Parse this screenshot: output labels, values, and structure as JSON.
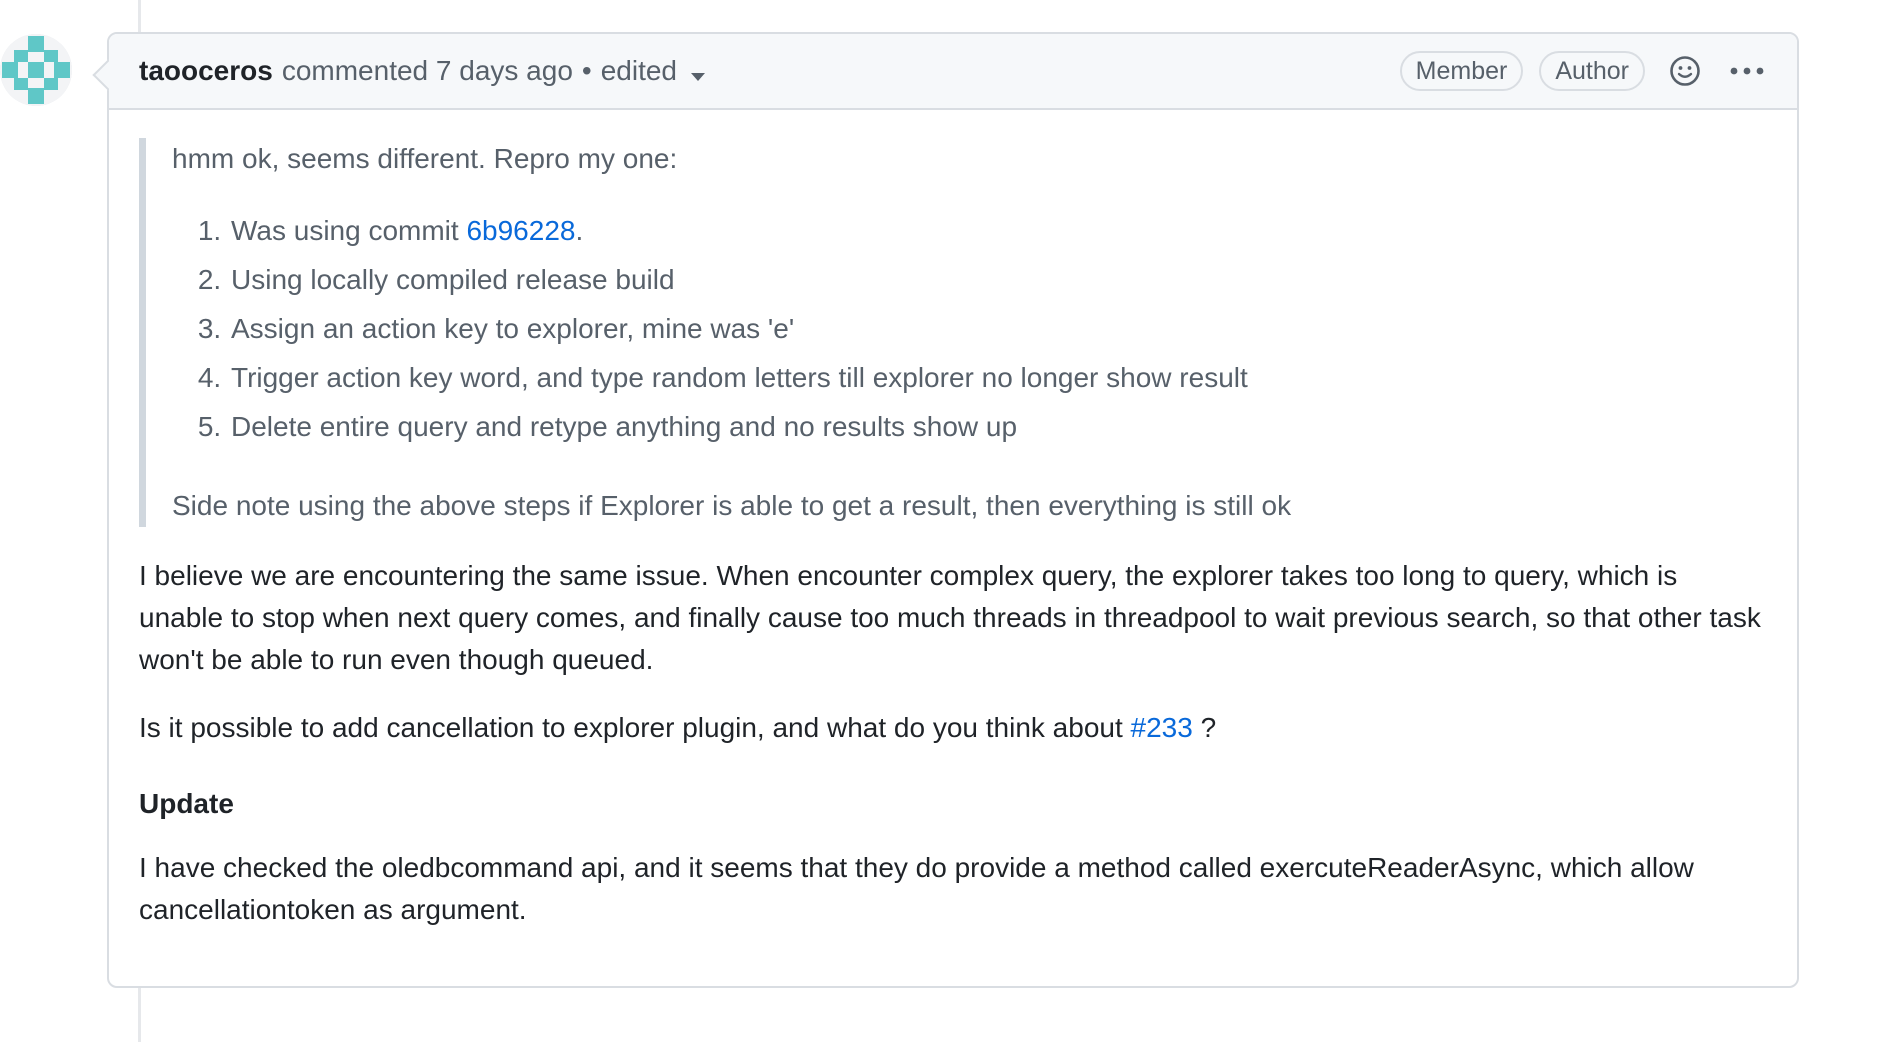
{
  "comment": {
    "author": "taooceros",
    "action_text": "commented 7 days ago",
    "bullet": "•",
    "edited_label": "edited",
    "badges": [
      "Member",
      "Author"
    ]
  },
  "quote": {
    "intro": "hmm ok, seems different. Repro my one:",
    "steps": [
      {
        "before": "Was using commit ",
        "link": "6b96228",
        "after": "."
      },
      {
        "before": "Using locally compiled release build",
        "link": "",
        "after": ""
      },
      {
        "before": "Assign an action key to explorer, mine was 'e'",
        "link": "",
        "after": ""
      },
      {
        "before": "Trigger action key word, and type random letters till explorer no longer show result",
        "link": "",
        "after": ""
      },
      {
        "before": "Delete entire query and retype anything and no results show up",
        "link": "",
        "after": ""
      }
    ],
    "side_note": "Side note using the above steps if Explorer is able to get a result, then everything is still ok"
  },
  "body": {
    "paragraph1": "I believe we are encountering the same issue. When encounter complex query, the explorer takes too long to query, which is unable to stop when next query comes, and finally cause too much threads in threadpool to wait previous search, so that other task won't be able to run even though queued.",
    "paragraph2_before": "Is it possible to add cancellation to explorer plugin, and what do you think about ",
    "paragraph2_link": "#233",
    "paragraph2_after": " ?",
    "update_heading": "Update",
    "paragraph3": "I have checked the oledbcommand api, and it seems that they do provide a method called exercuteReaderAsync, which allow cancellationtoken as argument."
  },
  "colors": {
    "link": "#0969da",
    "muted": "#57606a",
    "border": "#d9dde2",
    "avatar": "#5fc7c7"
  },
  "icons": {
    "avatar": "identicon-avatar",
    "caret": "caret-down-icon",
    "emoji": "smiley-icon",
    "more": "kebab-horizontal-icon"
  }
}
